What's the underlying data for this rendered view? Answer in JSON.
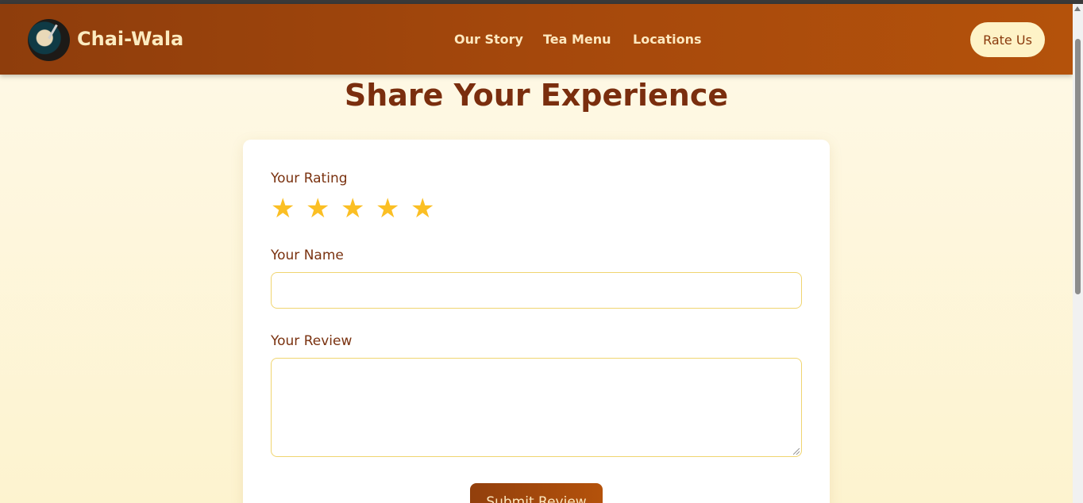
{
  "header": {
    "brand": "Chai-Wala",
    "nav": [
      "Our Story",
      "Tea Menu",
      "Locations"
    ],
    "cta": "Rate Us"
  },
  "page": {
    "title": "Share Your Experience"
  },
  "form": {
    "rating_label": "Your Rating",
    "rating_max": 5,
    "name_label": "Your Name",
    "name_value": "",
    "review_label": "Your Review",
    "review_value": "",
    "submit_label": "Submit Review"
  },
  "colors": {
    "header": "#a5480c",
    "accent_star": "#fbbf24",
    "title": "#7a2e0e"
  }
}
